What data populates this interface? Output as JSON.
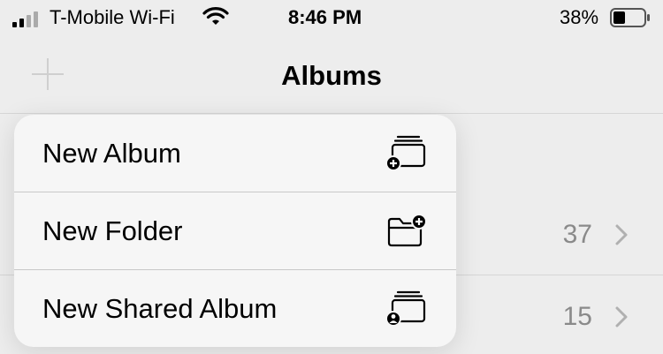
{
  "status_bar": {
    "carrier": "T-Mobile Wi-Fi",
    "time": "8:46 PM",
    "battery_percent": "38%"
  },
  "nav": {
    "title": "Albums"
  },
  "background_rows": [
    {
      "count": "37"
    },
    {
      "count": "15"
    }
  ],
  "menu": {
    "items": [
      {
        "label": "New Album",
        "icon": "new-album-icon"
      },
      {
        "label": "New Folder",
        "icon": "new-folder-icon"
      },
      {
        "label": "New Shared Album",
        "icon": "new-shared-album-icon"
      }
    ]
  }
}
